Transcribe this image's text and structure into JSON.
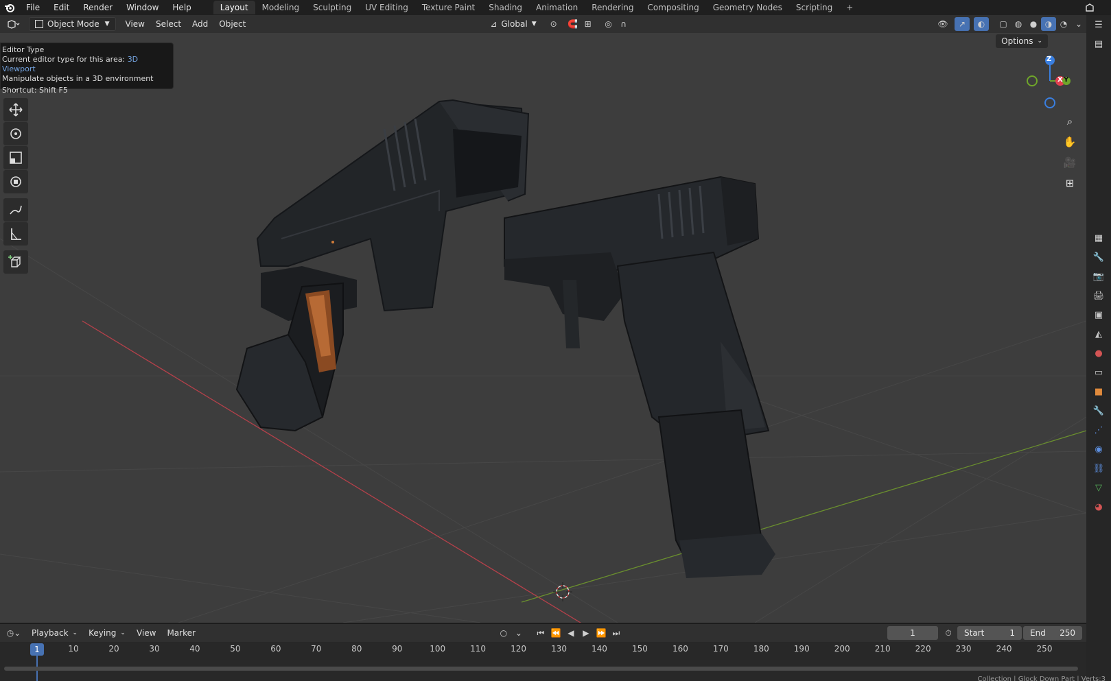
{
  "menu": {
    "items": [
      "File",
      "Edit",
      "Render",
      "Window",
      "Help"
    ]
  },
  "workspaces": {
    "tabs": [
      "Layout",
      "Modeling",
      "Sculpting",
      "UV Editing",
      "Texture Paint",
      "Shading",
      "Animation",
      "Rendering",
      "Compositing",
      "Geometry Nodes",
      "Scripting"
    ],
    "add_symbol": "+"
  },
  "viewport_header": {
    "mode": "Object Mode",
    "menus": [
      "View",
      "Select",
      "Add",
      "Object"
    ],
    "orientation": "Global",
    "options": "Options"
  },
  "tooltip": {
    "title": "Editor Type",
    "line2_prefix": "Current editor type for this area:",
    "line2_value": "3D Viewport",
    "line3": "Manipulate objects in a 3D environment",
    "shortcut": "Shortcut: Shift F5"
  },
  "gizmo": {
    "z": "Z",
    "x": "X",
    "y": "Y"
  },
  "timeline": {
    "menus": [
      "Playback",
      "Keying",
      "View",
      "Marker"
    ],
    "current_frame": "1",
    "start_label": "Start",
    "start_value": "1",
    "end_label": "End",
    "end_value": "250",
    "ticks": [
      "1",
      "10",
      "20",
      "30",
      "40",
      "50",
      "60",
      "70",
      "80",
      "90",
      "100",
      "110",
      "120",
      "130",
      "140",
      "150",
      "160",
      "170",
      "180",
      "190",
      "200",
      "210",
      "220",
      "230",
      "240",
      "250"
    ]
  },
  "status": {
    "text": "Collection | Glock Down Part | Verts:3"
  },
  "colors": {
    "accent": "#4772b3",
    "x_axis": "#e2404f",
    "y_axis": "#6fa62a",
    "z_axis": "#3a7fe0",
    "viewport_bg": "#3d3d3d"
  },
  "icons": {
    "blender_logo": "blender-logo-icon",
    "zoom": "zoom-icon",
    "pan": "hand-icon",
    "camera": "camera-icon",
    "grid": "grid-icon"
  }
}
